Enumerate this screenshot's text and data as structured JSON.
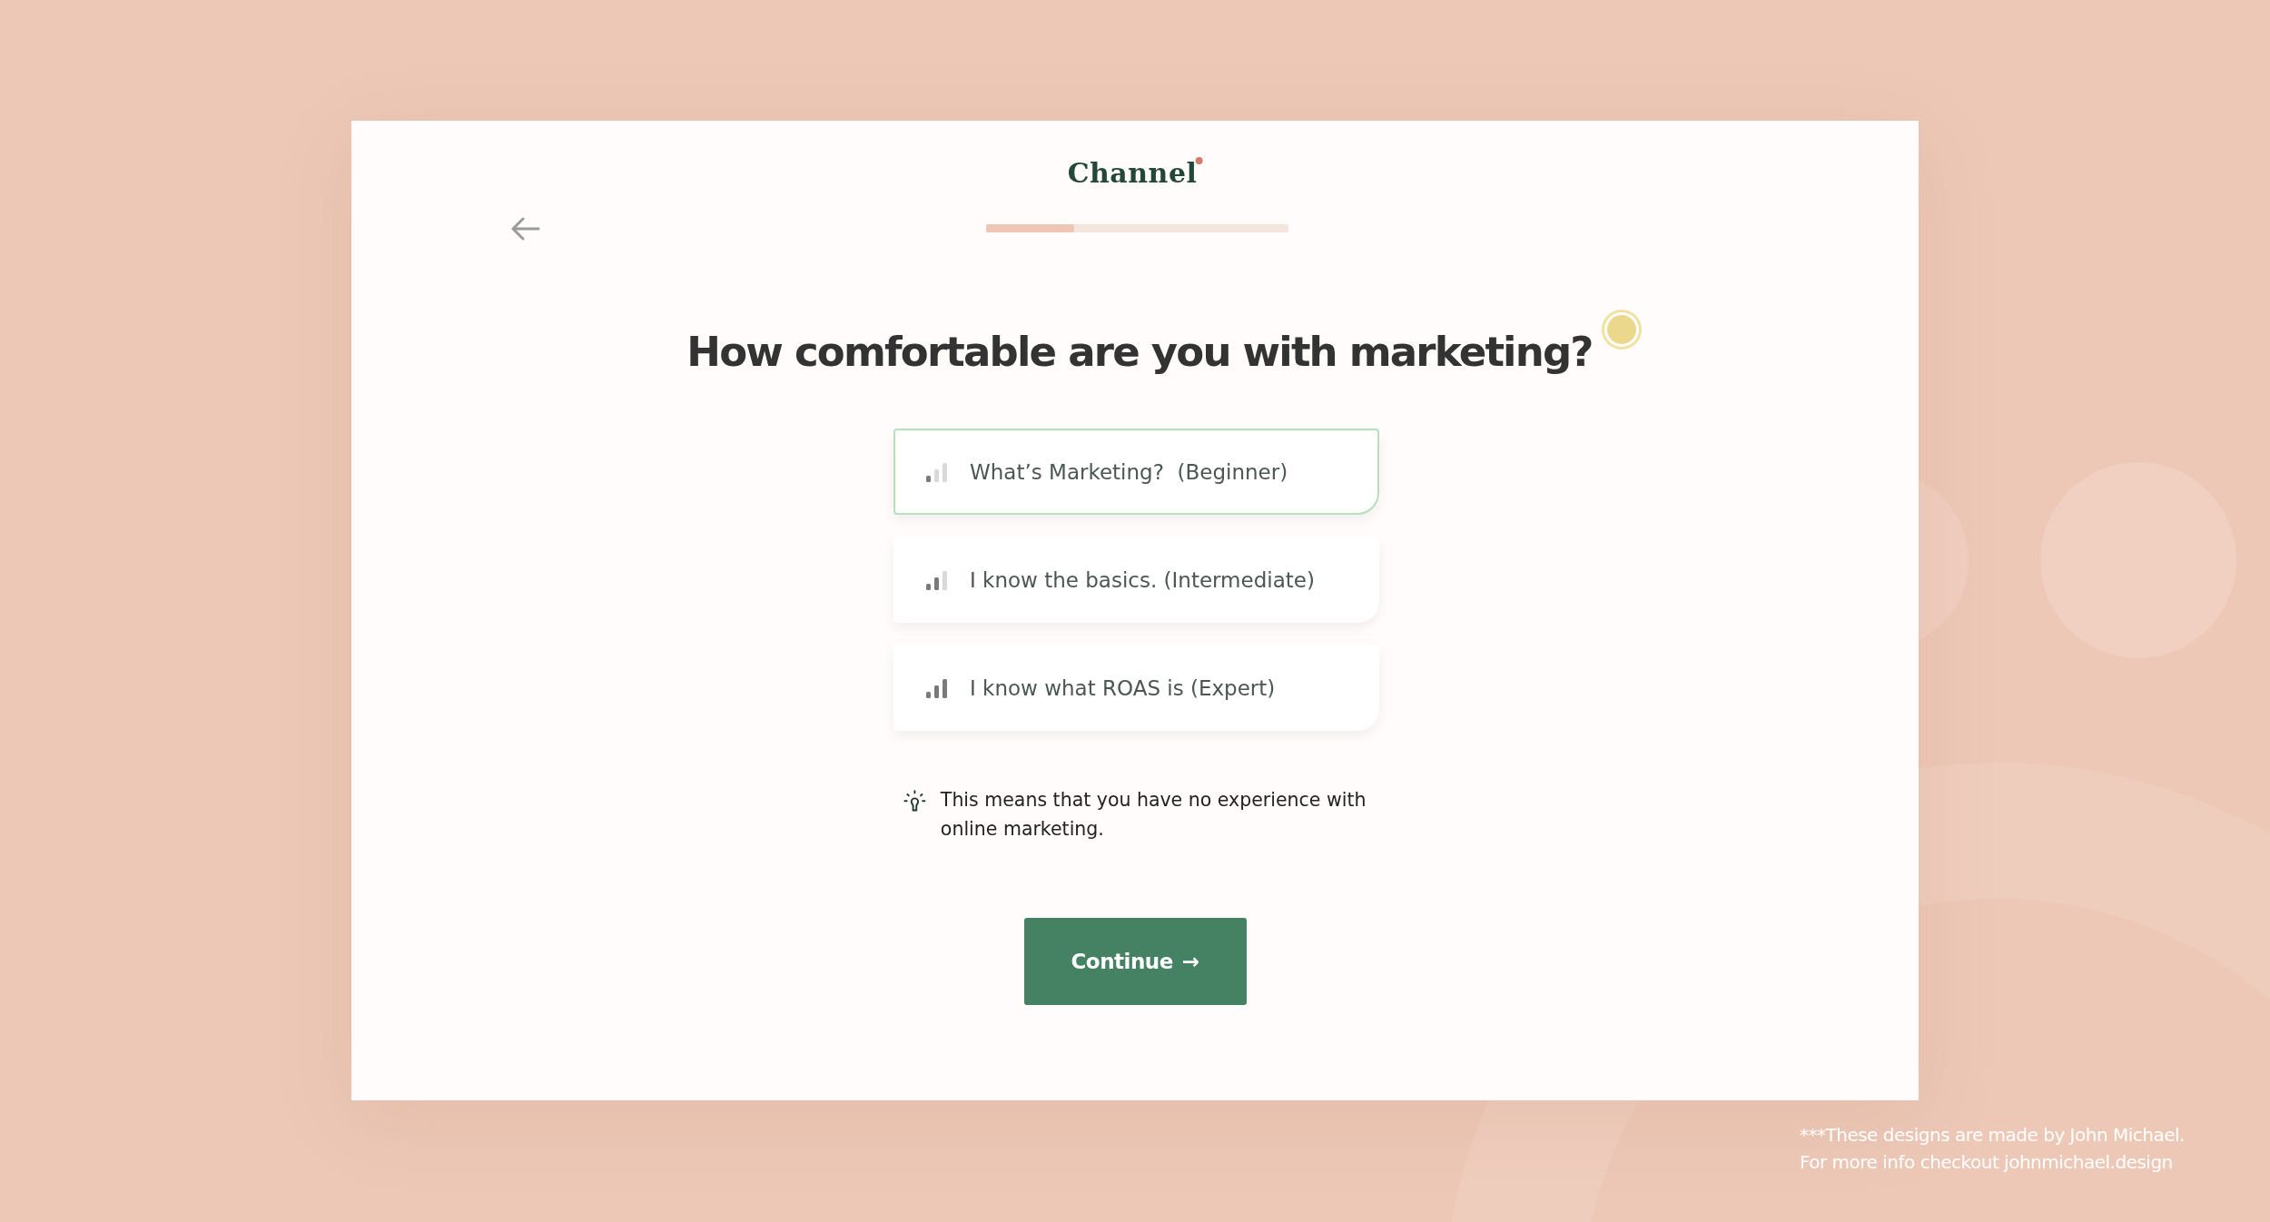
{
  "logo": {
    "text": "Channel"
  },
  "progress": {
    "level": 0.29
  },
  "question": "How comfortable are you with marketing?",
  "options": [
    {
      "label": "What’s Marketing?  (Beginner)",
      "kind": "low",
      "selected": true
    },
    {
      "label": "I know the basics. (Intermediate)",
      "kind": "medium",
      "selected": false
    },
    {
      "label": "I know what ROAS is (Expert)",
      "kind": "high",
      "selected": false
    }
  ],
  "hint": "This means that you have no experience with online marketing.",
  "continue_button": {
    "label": "Continue",
    "arrow": "→"
  },
  "credit": [
    "***These designs are made by John Michael.",
    "For more info checkout johnmichael.design"
  ]
}
